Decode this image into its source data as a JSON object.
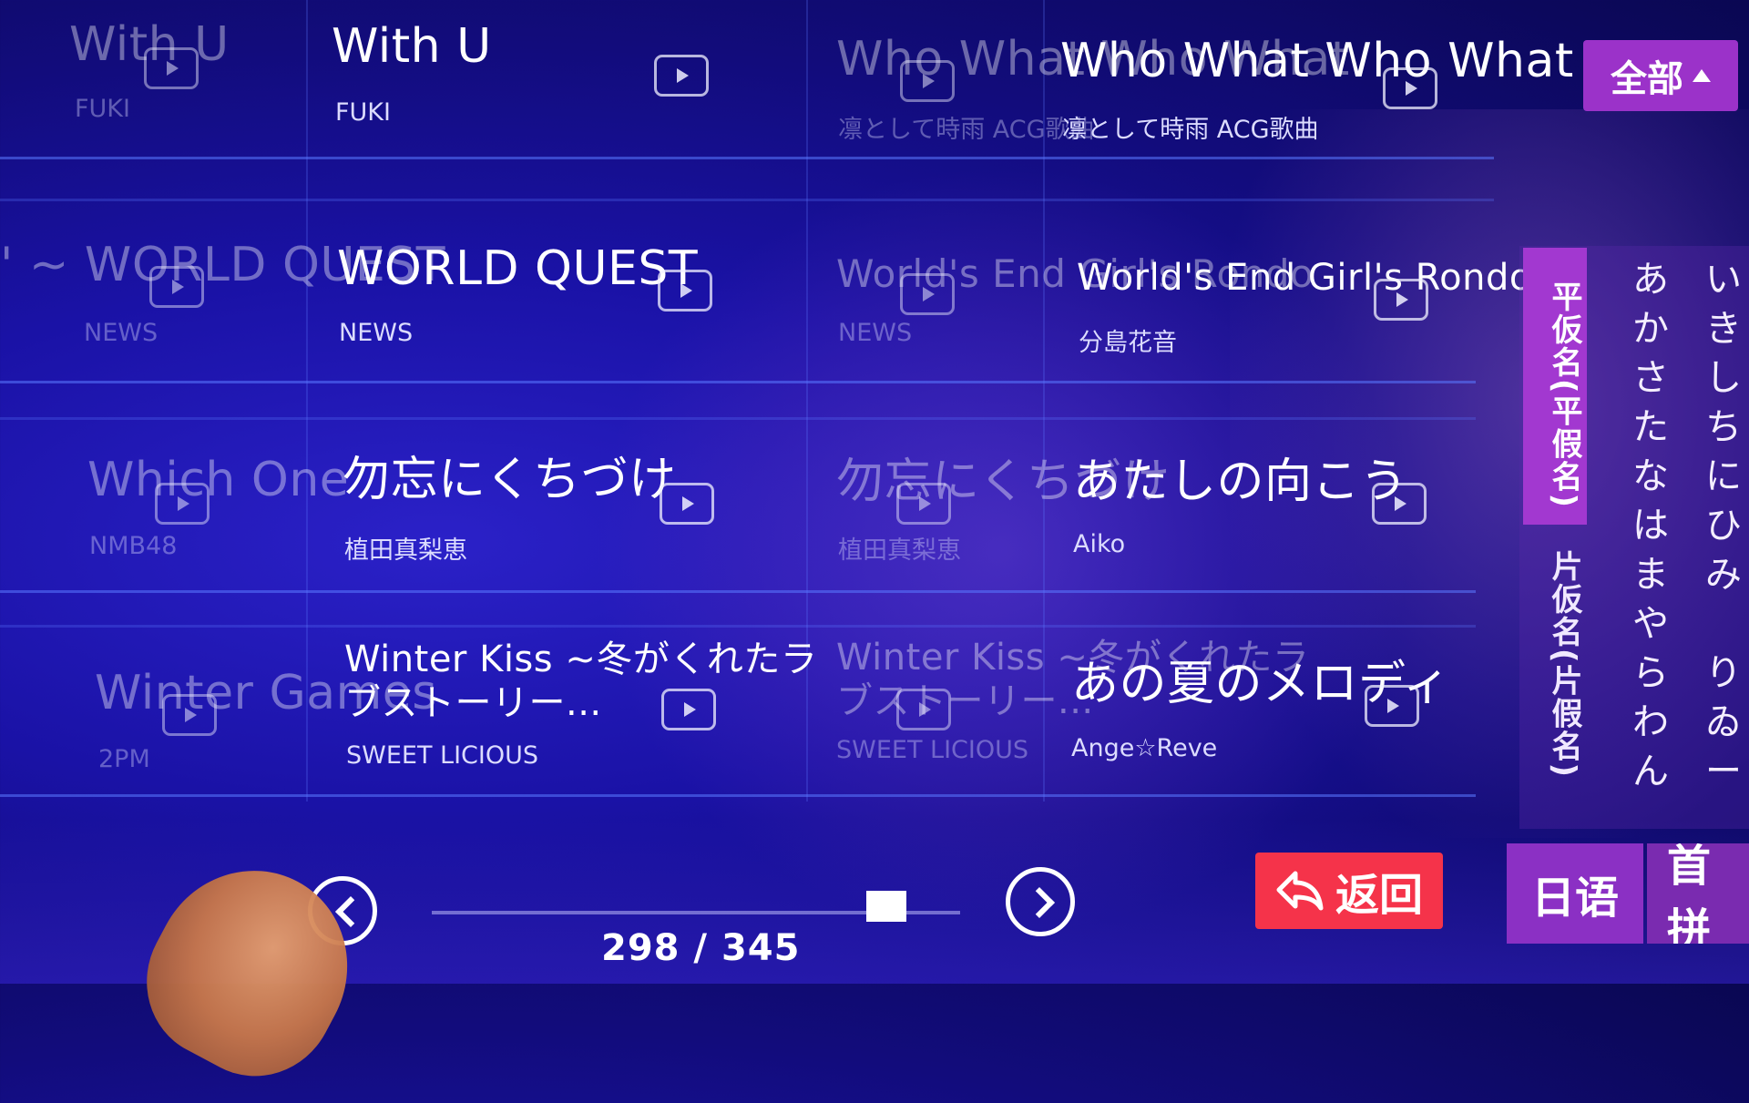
{
  "top_right": {
    "filter_button_label": "全部"
  },
  "rows": [
    {
      "ghost": {
        "title": "With U",
        "artist": "FUKI"
      },
      "left": {
        "title": "With U",
        "artist": "FUKI"
      },
      "right_ghost": {
        "title": "Who What Who What",
        "artist": "凛として時雨 ACG歌曲"
      },
      "right": {
        "title": "Who What Who What",
        "artist": "凛として時雨 ACG歌曲"
      }
    },
    {
      "ghost": {
        "title": "' ~ WORLD QUEST",
        "artist": "NEWS"
      },
      "left": {
        "title": "WORLD QUEST",
        "artist": "NEWS"
      },
      "right_ghost": {
        "title": "World's End Girl's Rondo",
        "artist": "NEWS"
      },
      "right": {
        "title": "World's End Girl's Rondo",
        "artist": "分島花音"
      }
    },
    {
      "ghost": {
        "title": "Which One",
        "artist": "NMB48"
      },
      "left": {
        "title": "勿忘にくちづけ",
        "artist": "植田真梨恵"
      },
      "right_ghost": {
        "title": "勿忘にくちづけ",
        "artist": "植田真梨恵"
      },
      "right": {
        "title": "あたしの向こう",
        "artist": "Aiko"
      }
    },
    {
      "ghost": {
        "title": "Winter Games",
        "artist": "2PM"
      },
      "left": {
        "title": "Winter Kiss ~冬がくれたラブストーリー...",
        "artist": "SWEET LICIOUS"
      },
      "right_ghost": {
        "title": "Winter Kiss ~冬がくれたラブストーリー...",
        "artist": "SWEET LICIOUS"
      },
      "right": {
        "title": "あの夏のメロディ",
        "artist": "Ange☆Reve"
      }
    }
  ],
  "side_index": {
    "tab_hiragana": "平仮名(平假名)",
    "tab_katakana": "片仮名(片假名)",
    "kana_column_1": [
      "あ",
      "か",
      "さ",
      "た",
      "な",
      "は",
      "ま",
      "や",
      "ら",
      "わ",
      "ん"
    ],
    "kana_column_2": [
      "い",
      "き",
      "し",
      "ち",
      "に",
      "ひ",
      "み",
      "",
      "り",
      "ゐ",
      "ー"
    ]
  },
  "bottom": {
    "page_counter": "298 / 345",
    "progress": 0.86,
    "back_label": "返回",
    "lang_active": "日语",
    "lang_inactive": "首拼"
  },
  "colors": {
    "accent_purple": "#9b32c9",
    "back_red": "#f5334a"
  }
}
